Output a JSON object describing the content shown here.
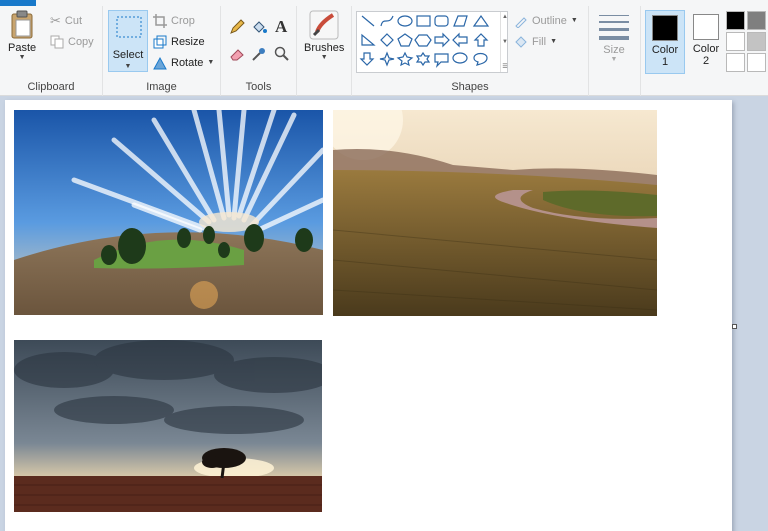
{
  "clipboard": {
    "paste_label": "Paste",
    "cut_label": "Cut",
    "copy_label": "Copy",
    "group_label": "Clipboard"
  },
  "image": {
    "select_label": "Select",
    "crop_label": "Crop",
    "resize_label": "Resize",
    "rotate_label": "Rotate",
    "group_label": "Image"
  },
  "tools": {
    "group_label": "Tools",
    "items": [
      "pencil-icon",
      "fill-icon",
      "text-icon",
      "eraser-icon",
      "color-picker-icon",
      "magnifier-icon"
    ]
  },
  "brushes": {
    "label": "Brushes"
  },
  "shapes": {
    "group_label": "Shapes",
    "outline_label": "Outline",
    "fill_label": "Fill"
  },
  "size": {
    "label": "Size"
  },
  "colors": {
    "color1_label": "Color",
    "color1_num": "1",
    "color2_label": "Color",
    "color2_num": "2",
    "color1_value": "#000000",
    "color2_value": "#ffffff",
    "palette": [
      "#000000",
      "#7f7f7f",
      "#ffffff",
      "#c3c3c3",
      "#ffffff",
      "#ffffff"
    ]
  },
  "theme": {
    "accent": "#1979ca",
    "selected_bg": "#cce4f7"
  }
}
